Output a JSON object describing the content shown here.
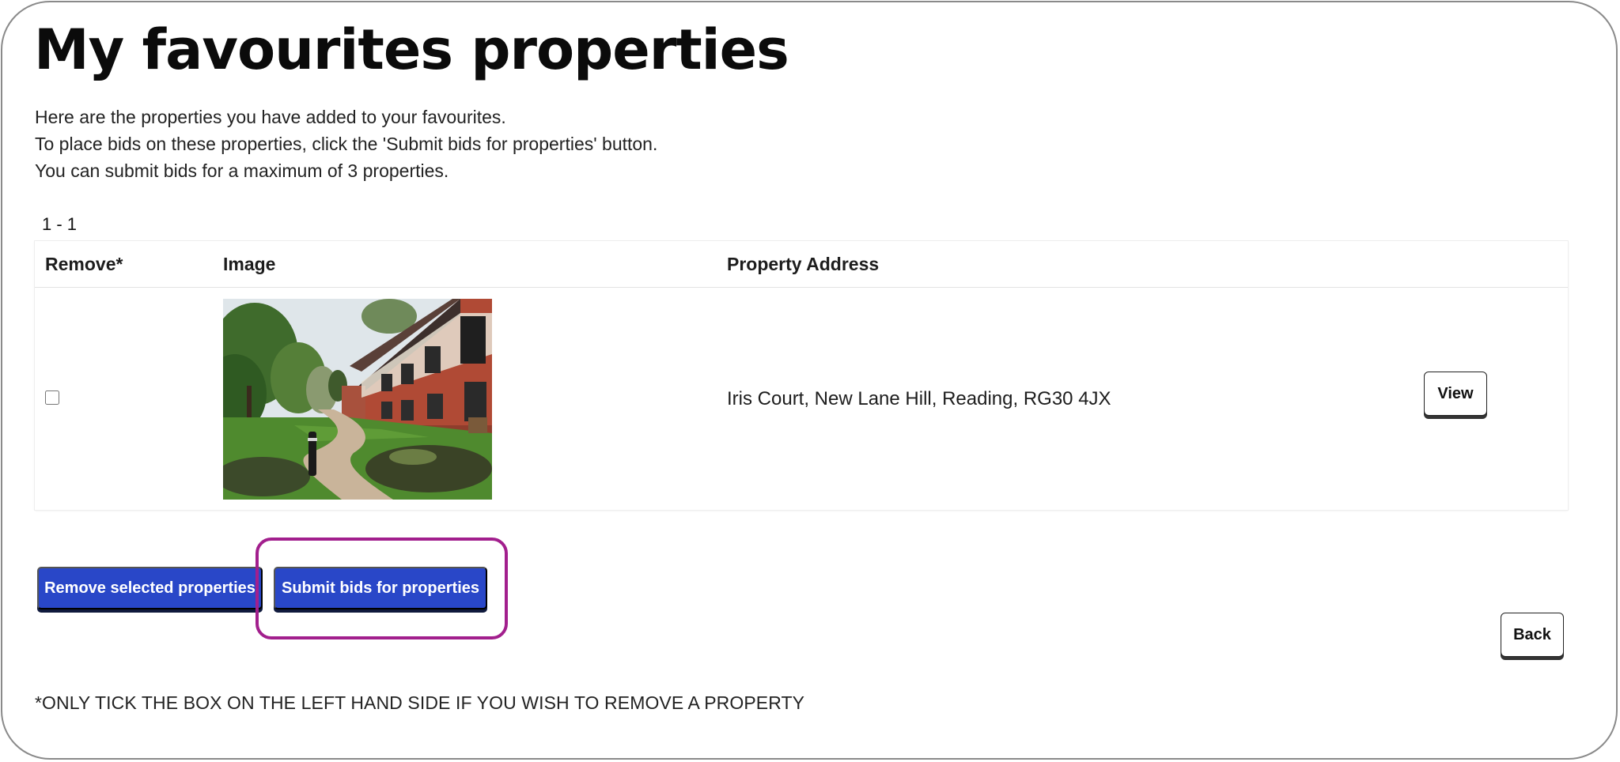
{
  "page": {
    "title": "My favourites properties",
    "intro_lines": [
      "Here are the properties you have added to your favourites.",
      "To place bids on these properties, click the 'Submit bids for properties' button.",
      "You can submit bids for a maximum of 3 properties."
    ]
  },
  "results": {
    "range": "1 - 1"
  },
  "table": {
    "columns": [
      "Remove*",
      "Image",
      "Property Address"
    ],
    "rows": [
      {
        "checked": false,
        "image": "property-photo",
        "address": "Iris Court, New Lane Hill, Reading, RG30 4JX",
        "view_label": "View"
      }
    ]
  },
  "actions": {
    "remove_label": "Remove selected properties",
    "submit_label": "Submit bids for properties",
    "back_label": "Back"
  },
  "footnote": "*ONLY TICK THE BOX ON THE LEFT HAND SIDE IF YOU WISH TO REMOVE A PROPERTY",
  "colors": {
    "primary_button": "#2947c8",
    "highlight": "#a21f8d",
    "frame_border": "#8a8a8a"
  }
}
